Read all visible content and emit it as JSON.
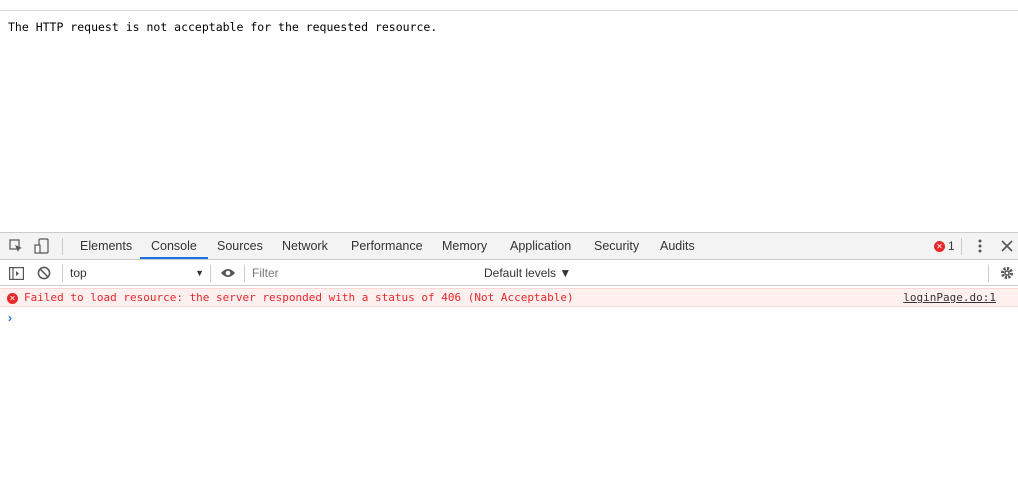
{
  "page": {
    "message": "The HTTP request is not acceptable for the requested resource."
  },
  "devtools": {
    "tabs": [
      {
        "label": "Elements"
      },
      {
        "label": "Console"
      },
      {
        "label": "Sources"
      },
      {
        "label": "Network"
      },
      {
        "label": "Performance"
      },
      {
        "label": "Memory"
      },
      {
        "label": "Application"
      },
      {
        "label": "Security"
      },
      {
        "label": "Audits"
      }
    ],
    "active_tab": "Console",
    "error_count": "1",
    "icons": {
      "inspect": "inspect-element-icon",
      "device": "device-toolbar-icon",
      "more": "kebab-menu-icon",
      "close": "close-icon",
      "sidebar": "console-sidebar-icon",
      "clear": "clear-console-icon",
      "eye": "eye-icon",
      "settings": "gear-icon"
    },
    "colors": {
      "accent": "#1a73e8",
      "error": "#e8272a",
      "error_bg": "#fff0f0"
    }
  },
  "filterbar": {
    "context": "top",
    "filter_placeholder": "Filter",
    "levels": "Default levels ▼"
  },
  "console": {
    "error_message": "Failed to load resource: the server responded with a status of 406 (Not Acceptable)",
    "error_source": "loginPage.do:1",
    "prompt_symbol": "›"
  }
}
